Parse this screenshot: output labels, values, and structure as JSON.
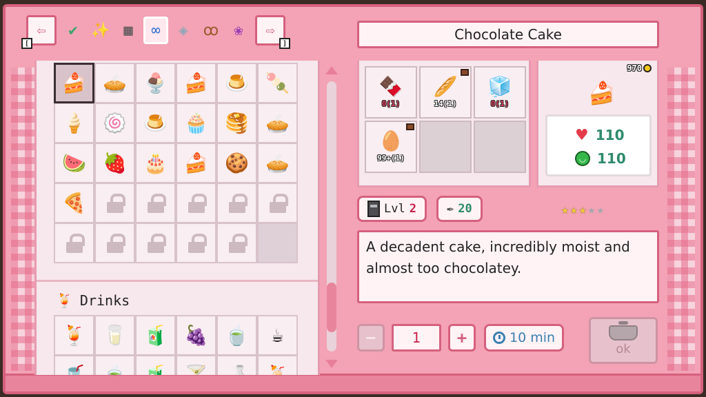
{
  "toolbar": {
    "prev_key": "[",
    "next_key": "]",
    "categories": [
      {
        "name": "check-category",
        "glyph": "✔",
        "color": "#3aa56a"
      },
      {
        "name": "sparkle-category",
        "glyph": "✨",
        "color": "#e2b82a"
      },
      {
        "name": "stove-category",
        "glyph": "▦",
        "color": "#555"
      },
      {
        "name": "infinity-category",
        "glyph": "∞",
        "color": "#2e6fd1"
      },
      {
        "name": "gem-category",
        "glyph": "◈",
        "color": "#8fa6b8"
      },
      {
        "name": "pretzel-category",
        "glyph": "ꝏ",
        "color": "#9b5a2d"
      },
      {
        "name": "salad-category",
        "glyph": "❀",
        "color": "#9c3fb4"
      }
    ]
  },
  "recipe": {
    "title": "Chocolate Cake",
    "price": "970",
    "health": "110",
    "energy": "110",
    "level_label": "Lvl",
    "level_value": "2",
    "xp_value": "20",
    "stars_filled": 3,
    "stars_total": 5,
    "description": "A decadent cake, incredibly moist and almost too chocolatey.",
    "quantity": "1",
    "time": "10 min",
    "ok_label": "ok"
  },
  "ingredients": [
    {
      "icon": "chocolate-icon",
      "glyph": "🍫",
      "count": "0(1)",
      "short": true,
      "chest": false
    },
    {
      "icon": "flour-sack-icon",
      "glyph": "🥖",
      "count": "14(1)",
      "short": false,
      "chest": true
    },
    {
      "icon": "sugar-icon",
      "glyph": "🧊",
      "count": "0(1)",
      "short": true,
      "chest": false
    },
    {
      "icon": "egg-icon",
      "glyph": "🥚",
      "count": "99+(1)",
      "short": false,
      "chest": true
    },
    {
      "icon": "",
      "glyph": "",
      "count": "",
      "empty": true
    },
    {
      "icon": "",
      "glyph": "",
      "count": "",
      "empty": true
    }
  ],
  "recipes_grid": [
    {
      "icon": "chocolate-cake-icon",
      "glyph": "🍰",
      "selected": true
    },
    {
      "icon": "pie-icon",
      "glyph": "🥧"
    },
    {
      "icon": "parfait-icon",
      "glyph": "🍨"
    },
    {
      "icon": "cake-slice-icon",
      "glyph": "🍰"
    },
    {
      "icon": "custard-icon",
      "glyph": "🍮"
    },
    {
      "icon": "macaron-icon",
      "glyph": "🍡"
    },
    {
      "icon": "cream-icon",
      "glyph": "🍦"
    },
    {
      "icon": "roll-cake-icon",
      "glyph": "🍥"
    },
    {
      "icon": "pudding-icon",
      "glyph": "🍮"
    },
    {
      "icon": "cupcake-icon",
      "glyph": "🧁"
    },
    {
      "icon": "pancake-icon",
      "glyph": "🥞"
    },
    {
      "icon": "tart-icon",
      "glyph": "🥧"
    },
    {
      "icon": "watermelon-slice-icon",
      "glyph": "🍉"
    },
    {
      "icon": "strawberry-icon",
      "glyph": "🍓"
    },
    {
      "icon": "layer-cake-icon",
      "glyph": "🎂"
    },
    {
      "icon": "cheesecake-icon",
      "glyph": "🍰"
    },
    {
      "icon": "cookies-icon",
      "glyph": "🍪"
    },
    {
      "icon": "jam-tart-icon",
      "glyph": "🥧"
    },
    {
      "icon": "pizza-slice-icon",
      "glyph": "🍕"
    },
    {
      "locked": true
    },
    {
      "locked": true
    },
    {
      "locked": true
    },
    {
      "locked": true
    },
    {
      "locked": true
    },
    {
      "locked": true
    },
    {
      "locked": true
    },
    {
      "locked": true
    },
    {
      "locked": true
    },
    {
      "locked": true
    },
    {
      "empty": true
    }
  ],
  "drinks": {
    "label": "Drinks",
    "items": [
      {
        "icon": "fruit-juice-icon",
        "glyph": "🍹"
      },
      {
        "icon": "milk-icon",
        "glyph": "🥛"
      },
      {
        "icon": "berry-juice-icon",
        "glyph": "🧃"
      },
      {
        "icon": "grape-juice-icon",
        "glyph": "🍇"
      },
      {
        "icon": "tea-cup-icon",
        "glyph": "🍵"
      },
      {
        "icon": "cocoa-icon",
        "glyph": "☕"
      },
      {
        "icon": "drink-7-icon",
        "glyph": "🥤"
      },
      {
        "icon": "drink-8-icon",
        "glyph": "🍵"
      },
      {
        "icon": "drink-9-icon",
        "glyph": "🧃"
      },
      {
        "icon": "drink-10-icon",
        "glyph": "🍸"
      },
      {
        "icon": "drink-11-icon",
        "glyph": "🍶"
      },
      {
        "icon": "drink-12-icon",
        "glyph": "🍹"
      }
    ]
  }
}
